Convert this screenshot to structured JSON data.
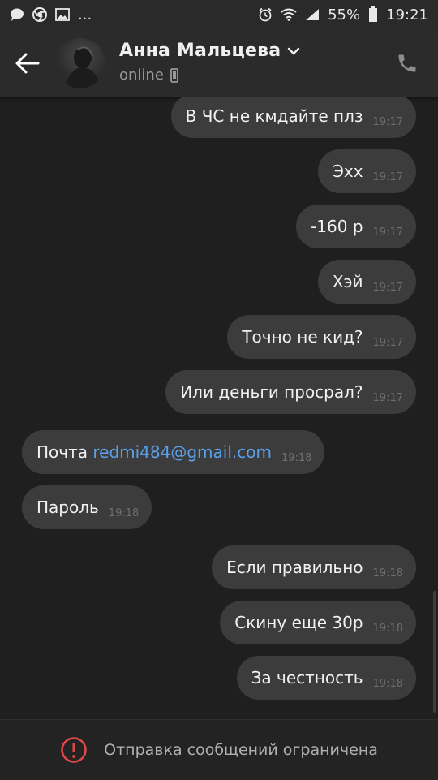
{
  "status_bar": {
    "dots": "...",
    "battery_percent": "55%",
    "time": "19:21"
  },
  "header": {
    "contact_name": "Анна Мальцева",
    "status": "online"
  },
  "messages": [
    {
      "direction": "out",
      "text": "В ЧС не кмдайте плз",
      "time": "19:17"
    },
    {
      "direction": "out",
      "text": "Эхх",
      "time": "19:17"
    },
    {
      "direction": "out",
      "text": "-160 р",
      "time": "19:17"
    },
    {
      "direction": "out",
      "text": "Хэй",
      "time": "19:17"
    },
    {
      "direction": "out",
      "text": "Точно не кид?",
      "time": "19:17"
    },
    {
      "direction": "out",
      "text": "Или деньги просрал?",
      "time": "19:17"
    },
    {
      "direction": "in",
      "text": "Почта ",
      "link": "redmi484@gmail.com",
      "time": "19:18"
    },
    {
      "direction": "in",
      "text": "Пароль",
      "time": "19:18"
    },
    {
      "direction": "out",
      "text": "Если правильно",
      "time": "19:18"
    },
    {
      "direction": "out",
      "text": "Скину еще 30р",
      "time": "19:18"
    },
    {
      "direction": "out",
      "text": "За честность",
      "time": "19:18"
    }
  ],
  "footer": {
    "notice": "Отправка сообщений ограничена"
  },
  "colors": {
    "background": "#1f1f1f",
    "bubble": "#3c3c3c",
    "link": "#5aa0ea",
    "alert": "#e04848"
  }
}
